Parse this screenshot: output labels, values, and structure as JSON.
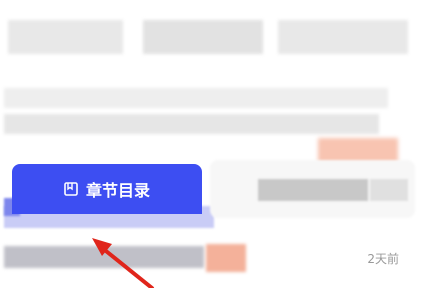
{
  "chapter_button": {
    "label": "章节目录",
    "icon": "book-icon",
    "color": "#3d4ef2"
  },
  "meta": {
    "time_ago": "2天前"
  },
  "annotation": {
    "color": "#e0251b",
    "icon": "red-arrow"
  }
}
